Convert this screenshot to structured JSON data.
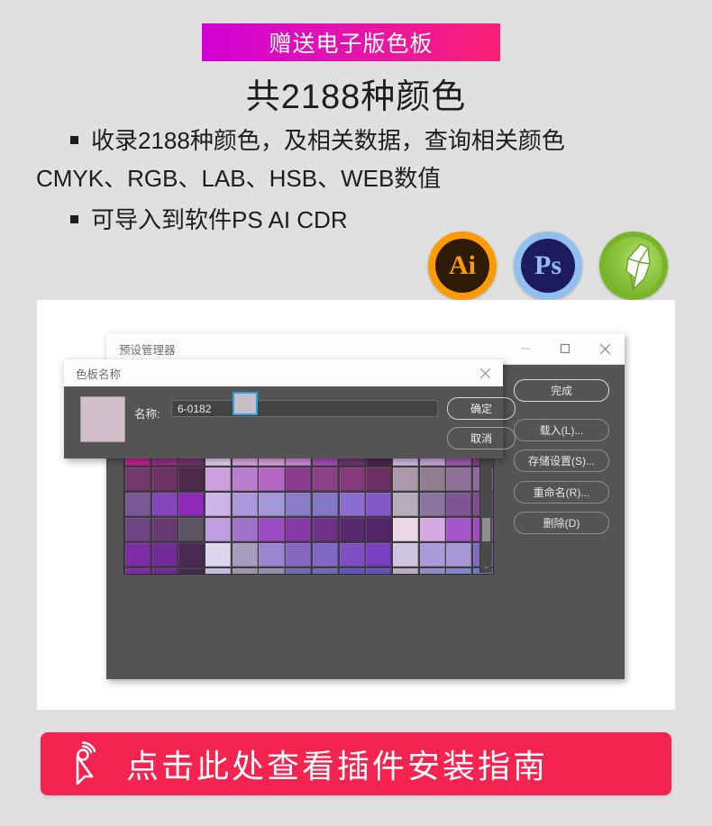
{
  "promo": {
    "ribbon_text": "赠送电子版色板",
    "gradient_from": "#d000d6",
    "gradient_to": "#fb1f74"
  },
  "headline": "共2188种颜色",
  "bullets": {
    "line1": "收录2188种颜色，及相关数据，查询相关颜色",
    "line2": "CMYK、RGB、LAB、HSB、WEB数值",
    "line3": "可导入到软件PS AI CDR"
  },
  "app_icons": [
    {
      "name": "illustrator",
      "glyph": "Ai",
      "ring": "#ff9a00",
      "fill": "#2e1b06"
    },
    {
      "name": "photoshop",
      "glyph": "Ps",
      "ring": "#8fc0f0",
      "fill": "#1d1b5e"
    },
    {
      "name": "coreldraw",
      "glyph": "",
      "ring": "#7ab429",
      "fill": "#8cc63f"
    }
  ],
  "preset_manager": {
    "title": "预设管理器",
    "window_controls": {
      "minimize": "—",
      "maximize": "□",
      "close": "✕"
    },
    "buttons": [
      {
        "label": "完成",
        "primary": true
      },
      {
        "label": "载入(L)...",
        "primary": false
      },
      {
        "label": "存储设置(S)...",
        "primary": false
      },
      {
        "label": "重命名(R)...",
        "primary": false
      },
      {
        "label": "删除(D)",
        "primary": false
      }
    ],
    "scrollbar": {
      "down_arrow": "⌄"
    }
  },
  "color_name_dialog": {
    "title": "色板名称",
    "close": "✕",
    "field_label": "名称:",
    "field_value": "6-0182",
    "field_placeholder": "6-0182",
    "preview_color": "#d2bdcb",
    "ok_label": "确定",
    "cancel_label": "取消"
  },
  "swatch_grid": {
    "columns": 14,
    "selected_index": 18,
    "colors": [
      "#7e3f6e",
      "#8c3a72",
      "#7a2a55",
      "#8e8e8e",
      "#a0a0a0",
      "#9a4f8a",
      "#9a4f8a",
      "#8d5f7a",
      "#8a4a6a",
      "#6b3550",
      "#b9b9b9",
      "#b4b4b4",
      "#b0b0b0",
      "#7b4f86",
      "#6e3a5e",
      "#6f3a5f",
      "#4e2437",
      "#d6cdd0",
      "#c9bccb",
      "#cfc4ca",
      "#b7a3b5",
      "#a3808f",
      "#8a5f6c",
      "#45262c",
      "#dfd3e8",
      "#c3aecb",
      "#c5abca",
      "#a883c0",
      "#743f7c",
      "#5f3560",
      "#58274a",
      "#e2dadb",
      "#b9a4b8",
      "#e2a0d8",
      "#b291c3",
      "#b682bd",
      "#bb5bc8",
      "#a936a8",
      "#e1b6e6",
      "#df7fd7",
      "#c32ab0",
      "#bf22a6",
      "#c21f95",
      "#95318b",
      "#7c3070",
      "#e7d3ef",
      "#dfa9e8",
      "#e2a2e0",
      "#ce91dd",
      "#ab4dbd",
      "#6f3574",
      "#4d2a4f",
      "#d5bde5",
      "#ccabe0",
      "#a458b4",
      "#8b3c84",
      "#73386e",
      "#6d3463",
      "#4e2848",
      "#ce9fdd",
      "#bb7fcf",
      "#b466c4",
      "#8b3a92",
      "#8b4088",
      "#87397f",
      "#6d2f63",
      "#ab98aa",
      "#917e90",
      "#8d6f97",
      "#8a6aa0",
      "#7a5795",
      "#8346b9",
      "#9029b8",
      "#cdb4e6",
      "#ab98dc",
      "#a497d8",
      "#8a7cc8",
      "#8676c6",
      "#8a6dce",
      "#8358c7",
      "#b4aebc",
      "#8b76a1",
      "#7e5493",
      "#7d4f8f",
      "#6d4585",
      "#6a3a72",
      "#5a5560",
      "#bd9ee0",
      "#a271c9",
      "#9a4bc0",
      "#8538a7",
      "#6f3189",
      "#59296e",
      "#542568",
      "#ecd8e9",
      "#d6a9e2",
      "#a455c9",
      "#a14ac4",
      "#7e2ca4",
      "#6e2c94",
      "#4a2a52",
      "#ded5ef",
      "#a69cbd",
      "#9a83d1",
      "#8769c4",
      "#8166c6",
      "#7e4ec3",
      "#7a3ec0",
      "#ccc4e0",
      "#a89bd6",
      "#a898d8",
      "#7f6ac2",
      "#7a2ba0",
      "#6d2a94",
      "#3f2b52",
      "#c3bce0",
      "#9b94ad",
      "#958fab",
      "#6f6bb2",
      "#6f68b4",
      "#5f56bd",
      "#5f4fbb",
      "#b9abc2",
      "#8c8ec8",
      "#7f86c9",
      "#6e79bd"
    ]
  },
  "cta": {
    "text": "点击此处查看插件安装指南",
    "background": "#f4234f"
  }
}
